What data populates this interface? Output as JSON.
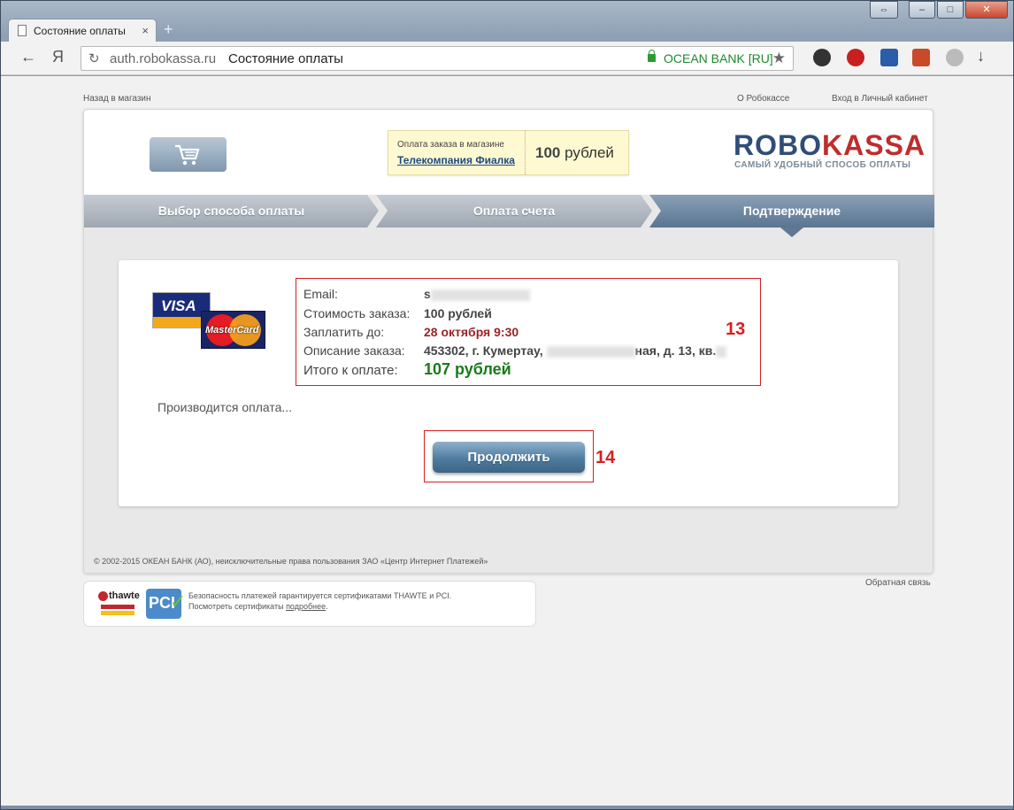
{
  "browser": {
    "tab_title": "Состояние оплаты",
    "tab_close": "×",
    "new_tab": "+",
    "window_buttons": [
      "⇔",
      "–",
      "□",
      "✕"
    ],
    "back": "←",
    "home": "Я",
    "reload": "↻",
    "url_host": "auth.robokassa.ru",
    "url_title": "Состояние оплаты",
    "security_label": "OCEAN BANK [RU]",
    "star": "★",
    "download": "↓"
  },
  "page": {
    "back_to_shop": "Назад в магазин",
    "about": "О Робокассе",
    "cabinet": "Вход в Личный кабинет",
    "order_label": "Оплата заказа в магазине",
    "shop_name": "Телекомпания Фиалка",
    "amount_number": "100",
    "amount_unit": "рублей",
    "logo_robo": "ROBO",
    "logo_kassa": "KASSA",
    "logo_tagline": "САМЫЙ УДОБНЫЙ СПОСОБ ОПЛАТЫ",
    "steps": [
      "Выбор способа оплаты",
      "Оплата счета",
      "Подтверждение"
    ],
    "cards": {
      "visa": "VISA",
      "mastercard": "MasterCard"
    },
    "details": {
      "email_label": "Email:",
      "email_value": "s",
      "cost_label": "Стоимость заказа:",
      "cost_value": "100 рублей",
      "pay_until_label": "Заплатить до:",
      "pay_until_value": "28 октября 9:30",
      "desc_label": "Описание заказа:",
      "desc_value_start": "453302, г. Кумертау,",
      "desc_value_end": "ная, д. 13, кв.",
      "total_label": "Итого к оплате:",
      "total_value": "107 рублей"
    },
    "annotation_13": "13",
    "annotation_14": "14",
    "processing": "Производится оплата...",
    "continue_button": "Продолжить",
    "copyright": "© 2002-2015 ОКЕАН БАНК (АО), неисключительные права пользования ЗАО «Центр Интернет Платежей»",
    "feedback": "Обратная связь",
    "security_line1": "Безопасность платежей гарантируется сертификатами THAWTE и PCI.",
    "security_line2": "Посмотреть сертификаты",
    "security_link": "подробнее",
    "security_dot": ".",
    "thawte": "thawte",
    "pci": "PCI",
    "pci_check": "✓"
  },
  "colors": {
    "accent_blue": "#2f4d78",
    "accent_red": "#c02d2d",
    "total_green": "#1a7a1a",
    "annotation_red": "#d81f1f"
  }
}
